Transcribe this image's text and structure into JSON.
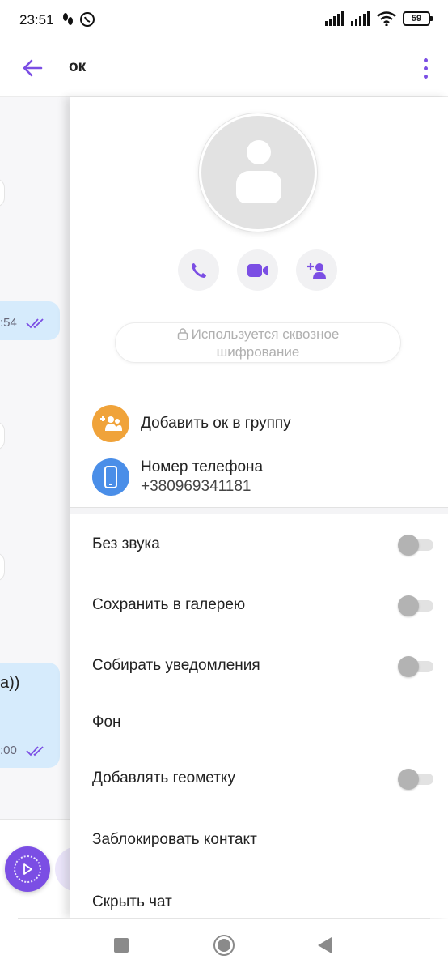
{
  "status_bar": {
    "time": "23:51",
    "battery": "59",
    "icons": [
      "pedometer-icon",
      "whatsapp-icon",
      "signal-icon",
      "signal-icon",
      "wifi-icon",
      "battery-icon"
    ]
  },
  "app_bar": {
    "title": "ок",
    "accent_color": "#7b4ee4"
  },
  "background_chat": {
    "bubble_times": [
      ":54",
      ":00"
    ],
    "bubble_text": "а))"
  },
  "contact": {
    "actions": [
      "call",
      "video-call",
      "add-participant"
    ],
    "encryption_notice_line1": "Используется сквозное",
    "encryption_notice_line2": "шифрование",
    "add_to_group": "Добавить ок в группу",
    "phone_label": "Номер телефона",
    "phone_number": "+380969341181"
  },
  "settings": [
    {
      "label": "Без звука",
      "toggle": false
    },
    {
      "label": "Сохранить в галерею",
      "toggle": false
    },
    {
      "label": "Собирать уведомления",
      "toggle": false
    },
    {
      "label": "Фон"
    },
    {
      "label": "Добавлять геометку",
      "toggle": false
    },
    {
      "label": "Заблокировать контакт"
    },
    {
      "label": "Скрыть чат"
    }
  ],
  "colors": {
    "accent": "#7b4ee4",
    "group_icon": "#f0a33a",
    "phone_icon": "#4a8ee8",
    "bubble": "#d6ebfc"
  }
}
